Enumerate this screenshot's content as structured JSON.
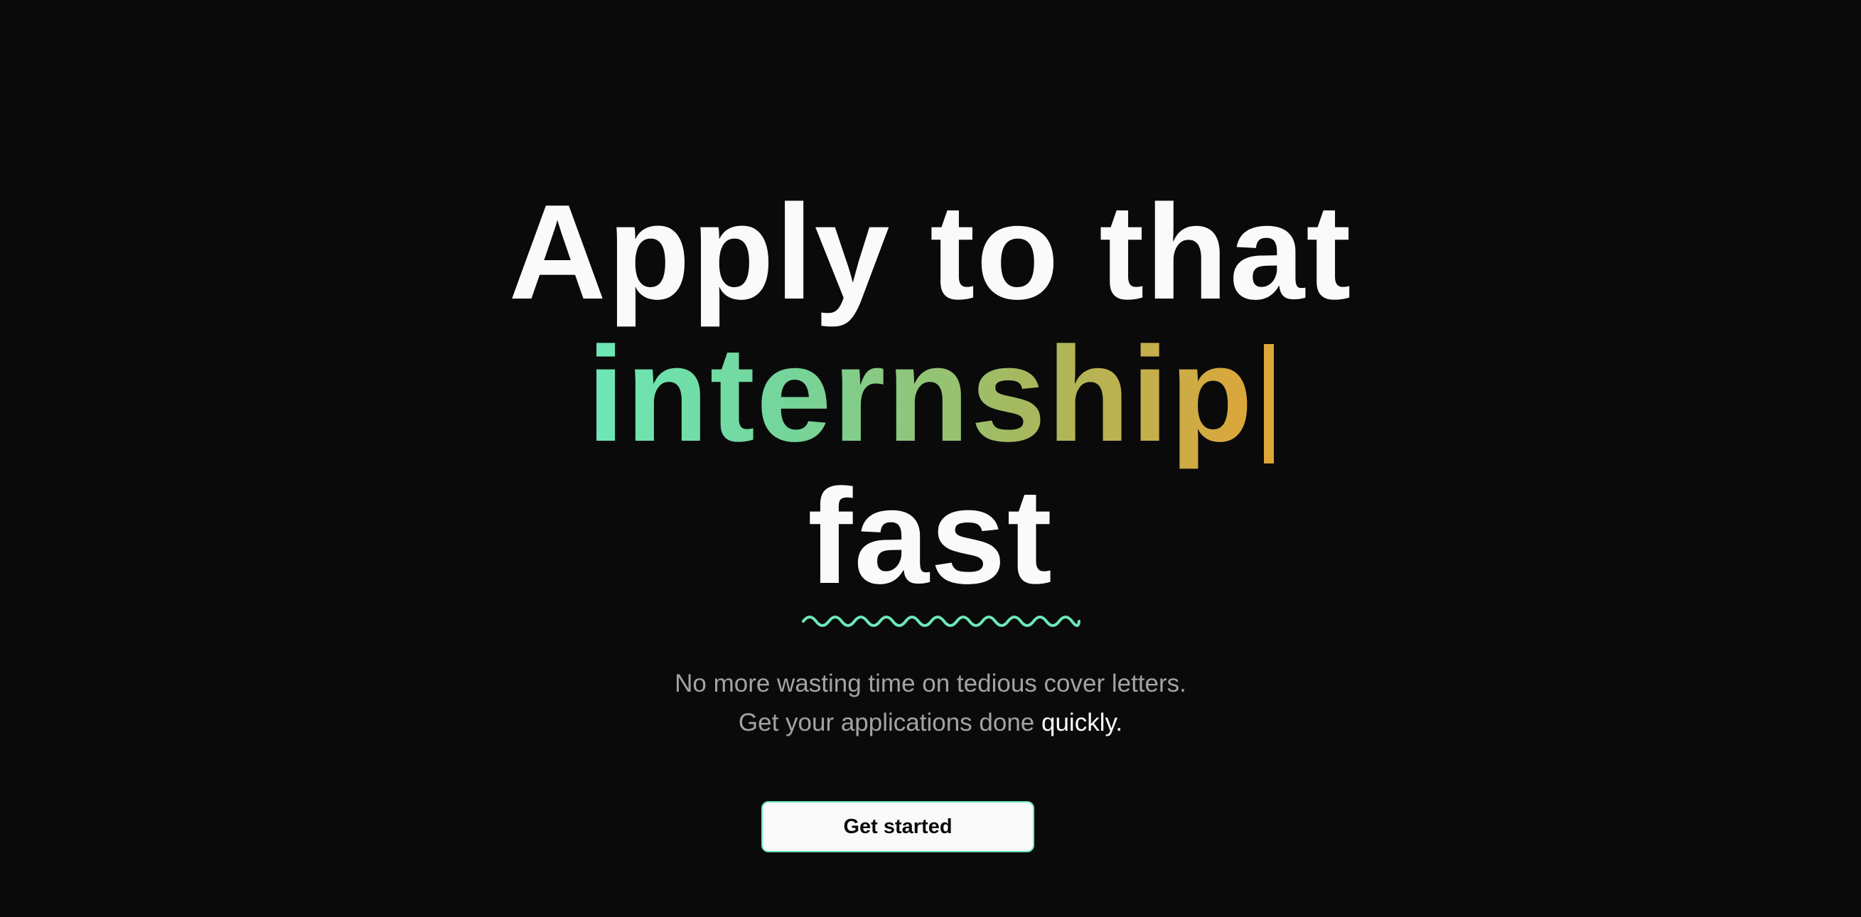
{
  "hero": {
    "line1": "Apply to that",
    "typed_word": "internship",
    "line3": "fast"
  },
  "subtitle": {
    "line1": "No more wasting time on tedious cover letters.",
    "line2_prefix": "Get your applications done ",
    "line2_highlight": "quickly."
  },
  "cta": {
    "label": "Get started"
  },
  "colors": {
    "background": "#0a0a0b",
    "text": "#fafafa",
    "muted": "#a3a3a3",
    "gradient_start": "#6ee7b7",
    "gradient_end": "#dda63a",
    "accent": "#6ee7b7"
  }
}
